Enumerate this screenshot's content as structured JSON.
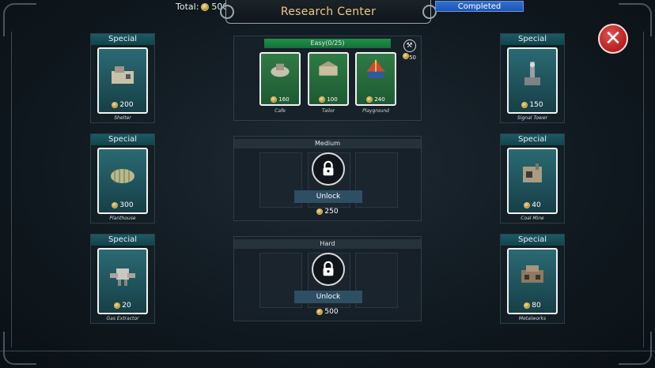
{
  "header": {
    "total_label": "Total:",
    "total_value": "500",
    "title": "Research Center",
    "status": "Completed",
    "close_symbol": "✕"
  },
  "left_cards": [
    {
      "tag": "Special",
      "price": "200",
      "name": "Shelter"
    },
    {
      "tag": "Special",
      "price": "300",
      "name": "Planthouse"
    },
    {
      "tag": "Special",
      "price": "20",
      "name": "Gas Extractor"
    }
  ],
  "right_cards": [
    {
      "tag": "Special",
      "price": "150",
      "name": "Signal Tower"
    },
    {
      "tag": "Special",
      "price": "40",
      "name": "Coal Mine"
    },
    {
      "tag": "Special",
      "price": "80",
      "name": "Metalworks"
    }
  ],
  "tiers": {
    "easy": {
      "label": "Easy(0/25)",
      "reward": "50",
      "items": [
        {
          "price": "160",
          "name": "Cafe"
        },
        {
          "price": "100",
          "name": "Tailor"
        },
        {
          "price": "240",
          "name": "Playground"
        }
      ]
    },
    "medium": {
      "label": "Medium",
      "button": "Unlock",
      "cost": "250"
    },
    "hard": {
      "label": "Hard",
      "button": "Unlock",
      "cost": "500"
    }
  },
  "colors": {
    "accent_title": "#f0c78a",
    "status_bar": "#2f6fd0",
    "special_header": "#1b5a64",
    "easy_header": "#20904a",
    "close": "#b51f1f"
  }
}
